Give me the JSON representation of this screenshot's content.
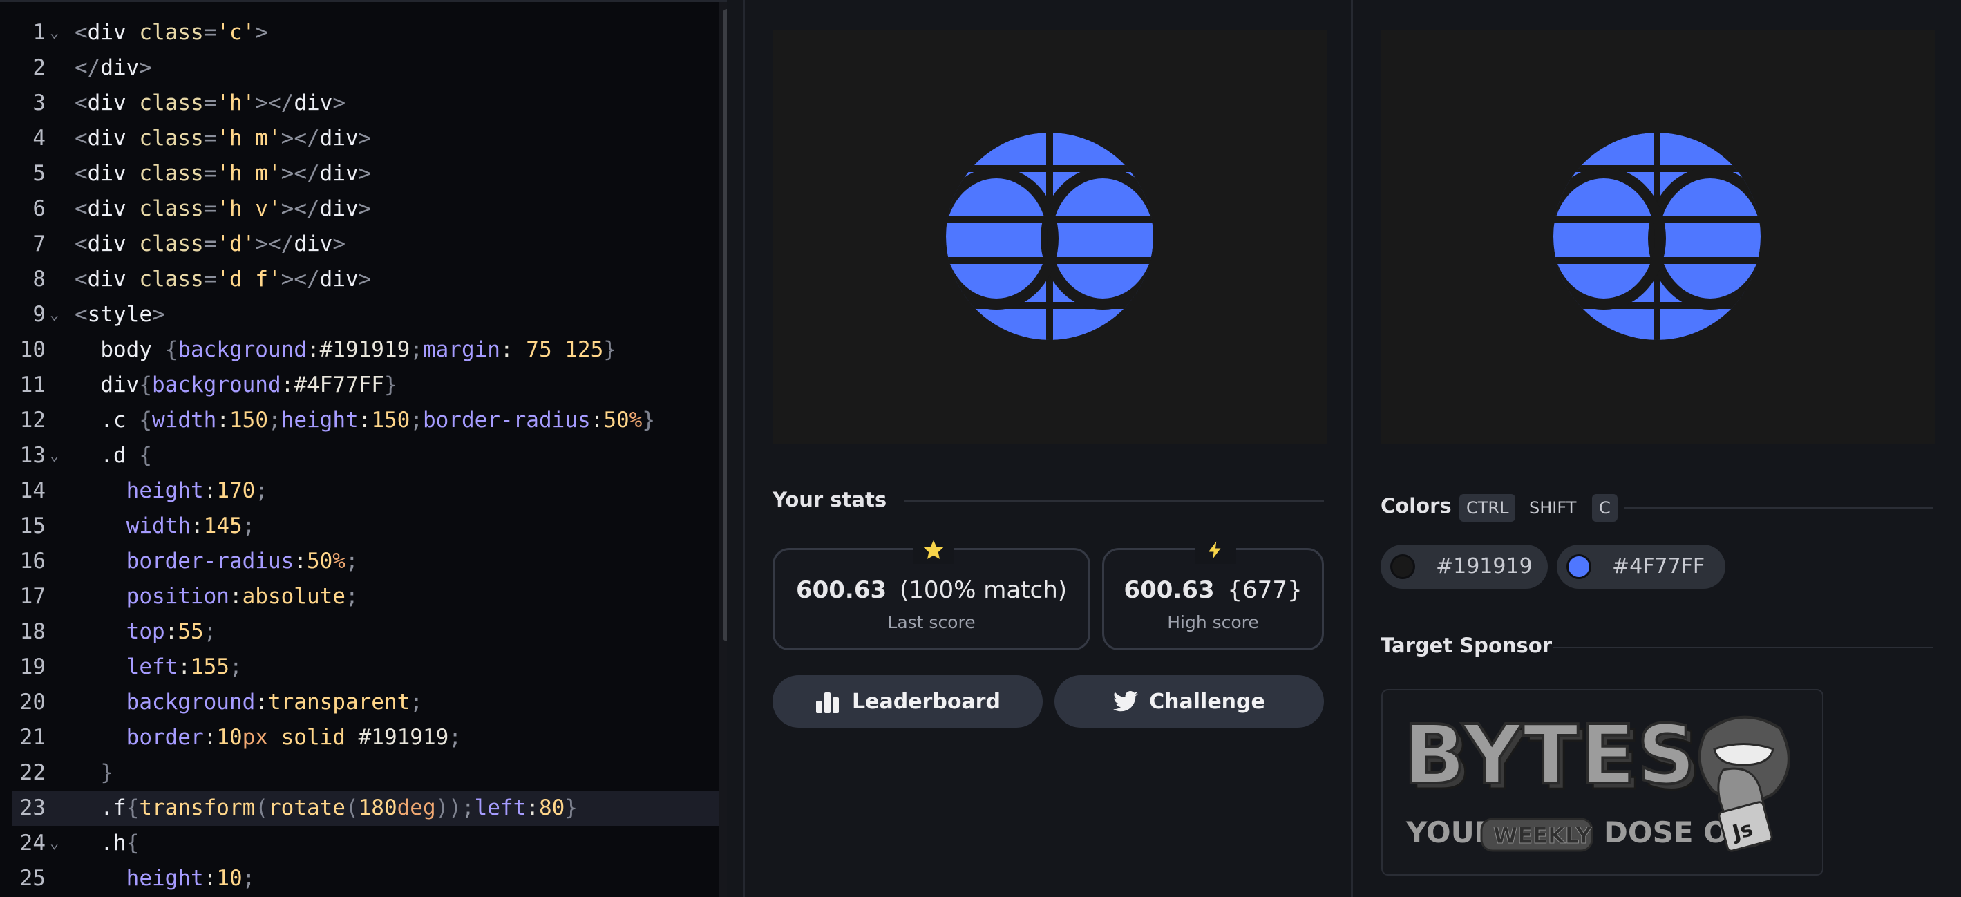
{
  "editor": {
    "lines": [
      {
        "n": "1",
        "fold": true,
        "tokens": [
          [
            "k-punc",
            "<"
          ],
          [
            "k-tag",
            "div "
          ],
          [
            "k-attr",
            "class"
          ],
          [
            "k-punc",
            "="
          ],
          [
            "k-str",
            "'c'"
          ],
          [
            "k-punc",
            ">"
          ]
        ]
      },
      {
        "n": "2",
        "fold": false,
        "tokens": [
          [
            "k-punc",
            "</"
          ],
          [
            "k-tag",
            "div"
          ],
          [
            "k-punc",
            ">"
          ]
        ]
      },
      {
        "n": "3",
        "fold": false,
        "tokens": [
          [
            "k-punc",
            "<"
          ],
          [
            "k-tag",
            "div "
          ],
          [
            "k-attr",
            "class"
          ],
          [
            "k-punc",
            "="
          ],
          [
            "k-str",
            "'h'"
          ],
          [
            "k-punc",
            "></"
          ],
          [
            "k-tag",
            "div"
          ],
          [
            "k-punc",
            ">"
          ]
        ]
      },
      {
        "n": "4",
        "fold": false,
        "tokens": [
          [
            "k-punc",
            "<"
          ],
          [
            "k-tag",
            "div "
          ],
          [
            "k-attr",
            "class"
          ],
          [
            "k-punc",
            "="
          ],
          [
            "k-str",
            "'h m'"
          ],
          [
            "k-punc",
            "></"
          ],
          [
            "k-tag",
            "div"
          ],
          [
            "k-punc",
            ">"
          ]
        ]
      },
      {
        "n": "5",
        "fold": false,
        "tokens": [
          [
            "k-punc",
            "<"
          ],
          [
            "k-tag",
            "div "
          ],
          [
            "k-attr",
            "class"
          ],
          [
            "k-punc",
            "="
          ],
          [
            "k-str",
            "'h m'"
          ],
          [
            "k-punc",
            "></"
          ],
          [
            "k-tag",
            "div"
          ],
          [
            "k-punc",
            ">"
          ]
        ]
      },
      {
        "n": "6",
        "fold": false,
        "tokens": [
          [
            "k-punc",
            "<"
          ],
          [
            "k-tag",
            "div "
          ],
          [
            "k-attr",
            "class"
          ],
          [
            "k-punc",
            "="
          ],
          [
            "k-str",
            "'h v'"
          ],
          [
            "k-punc",
            "></"
          ],
          [
            "k-tag",
            "div"
          ],
          [
            "k-punc",
            ">"
          ]
        ]
      },
      {
        "n": "7",
        "fold": false,
        "tokens": [
          [
            "k-punc",
            "<"
          ],
          [
            "k-tag",
            "div "
          ],
          [
            "k-attr",
            "class"
          ],
          [
            "k-punc",
            "="
          ],
          [
            "k-str",
            "'d'"
          ],
          [
            "k-punc",
            "></"
          ],
          [
            "k-tag",
            "div"
          ],
          [
            "k-punc",
            ">"
          ]
        ]
      },
      {
        "n": "8",
        "fold": false,
        "tokens": [
          [
            "k-punc",
            "<"
          ],
          [
            "k-tag",
            "div "
          ],
          [
            "k-attr",
            "class"
          ],
          [
            "k-punc",
            "="
          ],
          [
            "k-str",
            "'d f'"
          ],
          [
            "k-punc",
            "></"
          ],
          [
            "k-tag",
            "div"
          ],
          [
            "k-punc",
            ">"
          ]
        ]
      },
      {
        "n": "9",
        "fold": true,
        "tokens": [
          [
            "k-punc",
            "<"
          ],
          [
            "k-tag",
            "style"
          ],
          [
            "k-punc",
            ">"
          ]
        ]
      },
      {
        "n": "10",
        "fold": false,
        "tokens": [
          [
            "k-sel",
            "  body "
          ],
          [
            "k-brace",
            "{"
          ],
          [
            "k-prop",
            "background"
          ],
          [
            "k-plain",
            ":"
          ],
          [
            "k-plain",
            "#191919"
          ],
          [
            "k-punc",
            ";"
          ],
          [
            "k-prop",
            "margin"
          ],
          [
            "k-plain",
            ": "
          ],
          [
            "k-num",
            "75 125"
          ],
          [
            "k-brace",
            "}"
          ]
        ]
      },
      {
        "n": "11",
        "fold": false,
        "tokens": [
          [
            "k-sel",
            "  div"
          ],
          [
            "k-brace",
            "{"
          ],
          [
            "k-prop",
            "background"
          ],
          [
            "k-plain",
            ":"
          ],
          [
            "k-plain",
            "#4F77FF"
          ],
          [
            "k-brace",
            "}"
          ]
        ]
      },
      {
        "n": "12",
        "fold": false,
        "tokens": [
          [
            "k-sel",
            "  .c "
          ],
          [
            "k-brace",
            "{"
          ],
          [
            "k-prop",
            "width"
          ],
          [
            "k-plain",
            ":"
          ],
          [
            "k-num",
            "150"
          ],
          [
            "k-punc",
            ";"
          ],
          [
            "k-prop",
            "height"
          ],
          [
            "k-plain",
            ":"
          ],
          [
            "k-num",
            "150"
          ],
          [
            "k-punc",
            ";"
          ],
          [
            "k-prop",
            "border-radius"
          ],
          [
            "k-plain",
            ":"
          ],
          [
            "k-num",
            "50"
          ],
          [
            "k-unit",
            "%"
          ],
          [
            "k-brace",
            "}"
          ]
        ]
      },
      {
        "n": "13",
        "fold": true,
        "tokens": [
          [
            "k-sel",
            "  .d "
          ],
          [
            "k-brace",
            "{"
          ]
        ]
      },
      {
        "n": "14",
        "fold": false,
        "tokens": [
          [
            "k-prop",
            "    height"
          ],
          [
            "k-plain",
            ":"
          ],
          [
            "k-num",
            "170"
          ],
          [
            "k-punc",
            ";"
          ]
        ]
      },
      {
        "n": "15",
        "fold": false,
        "tokens": [
          [
            "k-prop",
            "    width"
          ],
          [
            "k-plain",
            ":"
          ],
          [
            "k-num",
            "145"
          ],
          [
            "k-punc",
            ";"
          ]
        ]
      },
      {
        "n": "16",
        "fold": false,
        "tokens": [
          [
            "k-prop",
            "    border-radius"
          ],
          [
            "k-plain",
            ":"
          ],
          [
            "k-num",
            "50"
          ],
          [
            "k-unit",
            "%"
          ],
          [
            "k-punc",
            ";"
          ]
        ]
      },
      {
        "n": "17",
        "fold": false,
        "tokens": [
          [
            "k-prop",
            "    position"
          ],
          [
            "k-plain",
            ":"
          ],
          [
            "k-str",
            "absolute"
          ],
          [
            "k-punc",
            ";"
          ]
        ]
      },
      {
        "n": "18",
        "fold": false,
        "tokens": [
          [
            "k-prop",
            "    top"
          ],
          [
            "k-plain",
            ":"
          ],
          [
            "k-num",
            "55"
          ],
          [
            "k-punc",
            ";"
          ]
        ]
      },
      {
        "n": "19",
        "fold": false,
        "tokens": [
          [
            "k-prop",
            "    left"
          ],
          [
            "k-plain",
            ":"
          ],
          [
            "k-num",
            "155"
          ],
          [
            "k-punc",
            ";"
          ]
        ]
      },
      {
        "n": "20",
        "fold": false,
        "tokens": [
          [
            "k-prop",
            "    background"
          ],
          [
            "k-plain",
            ":"
          ],
          [
            "k-str",
            "transparent"
          ],
          [
            "k-punc",
            ";"
          ]
        ]
      },
      {
        "n": "21",
        "fold": false,
        "tokens": [
          [
            "k-prop",
            "    border"
          ],
          [
            "k-plain",
            ":"
          ],
          [
            "k-num",
            "10"
          ],
          [
            "k-unit",
            "px"
          ],
          [
            "k-plain",
            " "
          ],
          [
            "k-str",
            "solid"
          ],
          [
            "k-plain",
            " #191919"
          ],
          [
            "k-punc",
            ";"
          ]
        ]
      },
      {
        "n": "22",
        "fold": false,
        "tokens": [
          [
            "k-brace",
            "  }"
          ]
        ]
      },
      {
        "n": "23",
        "fold": false,
        "active": true,
        "tokens": [
          [
            "k-sel",
            "  .f"
          ],
          [
            "k-brace",
            "{"
          ],
          [
            "k-str",
            "transform"
          ],
          [
            "k-brace",
            "("
          ],
          [
            "k-str",
            "rotate"
          ],
          [
            "k-brace",
            "("
          ],
          [
            "k-num",
            "180"
          ],
          [
            "k-unit",
            "deg"
          ],
          [
            "k-brace",
            "))"
          ],
          [
            "k-punc",
            ";"
          ],
          [
            "k-prop",
            "left"
          ],
          [
            "k-plain",
            ":"
          ],
          [
            "k-num",
            "80"
          ],
          [
            "k-brace",
            "}"
          ]
        ]
      },
      {
        "n": "24",
        "fold": true,
        "tokens": [
          [
            "k-sel",
            "  .h"
          ],
          [
            "k-brace",
            "{"
          ]
        ]
      },
      {
        "n": "25",
        "fold": false,
        "tokens": [
          [
            "k-prop",
            "    height"
          ],
          [
            "k-plain",
            ":"
          ],
          [
            "k-num",
            "10"
          ],
          [
            "k-punc",
            ";"
          ]
        ]
      }
    ]
  },
  "stats": {
    "heading": "Your stats",
    "last_score_value": "600.63",
    "last_score_match": "(100% match)",
    "last_score_label": "Last score",
    "high_score_value": "600.63",
    "high_score_extra": "{677}",
    "high_score_label": "High score",
    "leaderboard_label": "Leaderboard",
    "challenge_label": "Challenge"
  },
  "colors": {
    "heading": "Colors",
    "shortcut_ctrl": "CTRL",
    "shortcut_shift": "SHIFT",
    "shortcut_c": "C",
    "swatches": [
      {
        "hex": "#191919",
        "label": "#191919"
      },
      {
        "hex": "#4F77FF",
        "label": "#4F77FF"
      }
    ]
  },
  "sponsor": {
    "heading": "Target Sponsor",
    "title": "BYTES",
    "tagline_your": "YOUR",
    "tagline_weekly": "WEEKLY",
    "tagline_dose": "DOSE OF",
    "badge": "Js"
  },
  "theme": {
    "globe_color": "#4F77FF",
    "canvas_bg": "#191919",
    "star_color": "#f7d44a"
  }
}
